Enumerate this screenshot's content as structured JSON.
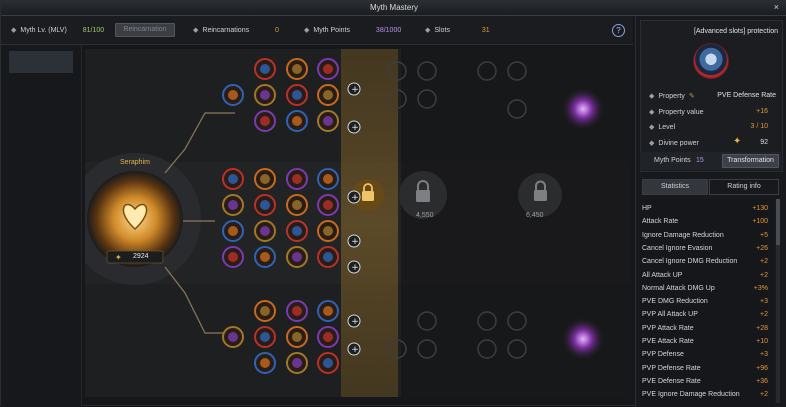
{
  "window": {
    "title": "Myth Mastery",
    "close_label": "×"
  },
  "topbar": {
    "myth_lv_label": "Myth Lv. (MLV)",
    "myth_lv_value": "81/100",
    "reincarnation_button": "Reincarnation",
    "reincarnations_label": "Reincarnations",
    "reincarnations_value": "0",
    "myth_points_label": "Myth Points",
    "myth_points_value": "38/1000",
    "slots_label": "Slots",
    "slots_value": "31",
    "help_label": "?"
  },
  "board": {
    "core_title": "Seraphim",
    "core_value": "2924",
    "lock_costs": [
      "4,550",
      "6,450"
    ]
  },
  "slot_panel": {
    "title": "[Advanced slots] protection",
    "property_label": "Property",
    "property_value": "PVE Defense Rate",
    "property_value_label": "Property value",
    "property_value_value": "+16",
    "level_label": "Level",
    "level_value": "3 / 10",
    "divine_power_label": "Divine power",
    "divine_power_value": "92",
    "myth_points_label": "Myth Points",
    "myth_points_value": "15",
    "transformation_button": "Transformation"
  },
  "tabs": {
    "statistics": "Statistics",
    "rating_info": "Rating info"
  },
  "statistics": [
    {
      "name": "HP",
      "value": "+130"
    },
    {
      "name": "Attack Rate",
      "value": "+100"
    },
    {
      "name": "Ignore Damage Reduction",
      "value": "+5"
    },
    {
      "name": "Cancel Ignore Evasion",
      "value": "+26"
    },
    {
      "name": "Cancel Ignore DMG Reduction",
      "value": "+2"
    },
    {
      "name": "All Attack UP",
      "value": "+2"
    },
    {
      "name": "Normal Attack DMG Up",
      "value": "+3%"
    },
    {
      "name": "PVE DMG Reduction",
      "value": "+3"
    },
    {
      "name": "PVP All Attack UP",
      "value": "+2"
    },
    {
      "name": "PVP Attack Rate",
      "value": "+28"
    },
    {
      "name": "PVE Attack Rate",
      "value": "+10"
    },
    {
      "name": "PVP Defense",
      "value": "+3"
    },
    {
      "name": "PVP Defense Rate",
      "value": "+96"
    },
    {
      "name": "PVE Defense Rate",
      "value": "+36"
    },
    {
      "name": "PVE Ignore Damage Reduction",
      "value": "+2"
    }
  ],
  "colors": {
    "orange": "#e39a3c",
    "green": "#9ec96a",
    "purple": "#b792e8",
    "gold": "#e8b24a"
  }
}
